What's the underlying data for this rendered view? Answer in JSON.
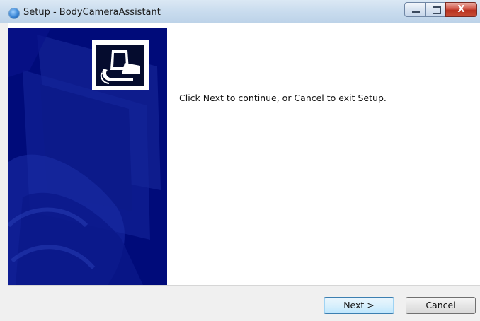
{
  "window": {
    "title": "Setup - BodyCameraAssistant",
    "controls": {
      "minimize_icon": "minimize-icon",
      "maximize_icon": "maximize-icon",
      "close_icon": "close-icon",
      "close_glyph": "X"
    }
  },
  "wizard": {
    "message": "Click Next to continue, or Cancel to exit Setup.",
    "logo_icon": "installer-computer-icon"
  },
  "buttons": {
    "next": "Next >",
    "cancel": "Cancel"
  },
  "colors": {
    "side_panel": "#000b7a",
    "close_button": "#c7402f"
  }
}
